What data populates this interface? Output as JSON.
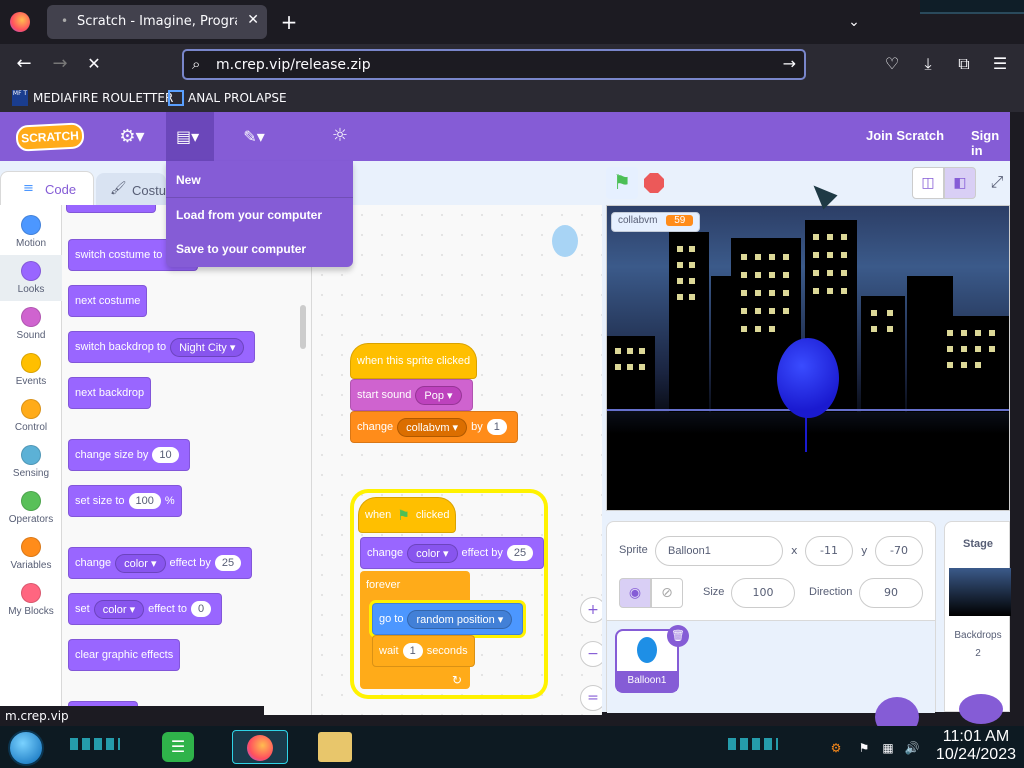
{
  "browser": {
    "tab_title": "Scratch - Imagine, Program, Sh",
    "url": "m.crep.vip/release.zip",
    "bookmarks": [
      {
        "icon_text": "MF T",
        "label": "MEDIAFIRE ROULETTER"
      },
      {
        "label": "ANAL PROLAPSE"
      }
    ],
    "status_url": "m.crep.vip"
  },
  "menubar": {
    "logo": "SCRATCH",
    "join": "Join Scratch",
    "signin": "Sign in"
  },
  "file_menu": {
    "items": [
      "New",
      "Load from your computer",
      "Save to your computer"
    ]
  },
  "tabs": {
    "code": "Code",
    "costumes": "Costu"
  },
  "categories": [
    {
      "label": "Motion",
      "color": "#4c97ff"
    },
    {
      "label": "Looks",
      "color": "#9966ff"
    },
    {
      "label": "Sound",
      "color": "#cf63cf"
    },
    {
      "label": "Events",
      "color": "#ffbf00"
    },
    {
      "label": "Control",
      "color": "#ffab19"
    },
    {
      "label": "Sensing",
      "color": "#5cb1d6"
    },
    {
      "label": "Operators",
      "color": "#59c059"
    },
    {
      "label": "Variables",
      "color": "#ff8c1a"
    },
    {
      "label": "My Blocks",
      "color": "#ff6680"
    }
  ],
  "palette": {
    "switch_costume": "switch costume to",
    "next_costume": "next costume",
    "switch_backdrop": "switch backdrop to",
    "backdrop_value": "Night City",
    "next_backdrop": "next backdrop",
    "change_size": "change size by",
    "change_size_val": "10",
    "set_size": "set size to",
    "set_size_val": "100",
    "set_size_unit": "%",
    "change_effect": "change",
    "change_effect_drop": "color",
    "change_effect_by": "effect by",
    "change_effect_val": "25",
    "set_effect": "set",
    "set_effect_drop": "color",
    "set_effect_to": "effect to",
    "set_effect_val": "0",
    "clear_effects": "clear graphic effects"
  },
  "script1": {
    "hat": "when this sprite clicked",
    "start_sound": "start sound",
    "sound_val": "Pop",
    "change": "change",
    "change_var": "collabvm",
    "by": "by",
    "by_val": "1"
  },
  "script2": {
    "hat_when": "when",
    "hat_clicked": "clicked",
    "change": "change",
    "change_drop": "color",
    "effect_by": "effect by",
    "effect_val": "25",
    "forever": "forever",
    "goto": "go to",
    "goto_val": "random position",
    "wait": "wait",
    "wait_val": "1",
    "seconds": "seconds"
  },
  "stage": {
    "var_name": "collabvm",
    "var_value": "59"
  },
  "sprite_info": {
    "sprite_label": "Sprite",
    "sprite_name": "Balloon1",
    "x_label": "x",
    "x_val": "-11",
    "y_label": "y",
    "y_val": "-70",
    "size_label": "Size",
    "size_val": "100",
    "dir_label": "Direction",
    "dir_val": "90",
    "thumb_name": "Balloon1"
  },
  "stage_panel": {
    "title": "Stage",
    "backdrops_label": "Backdrops",
    "backdrops_count": "2"
  },
  "clock": {
    "time": "11:01 AM",
    "date": "10/24/2023"
  }
}
